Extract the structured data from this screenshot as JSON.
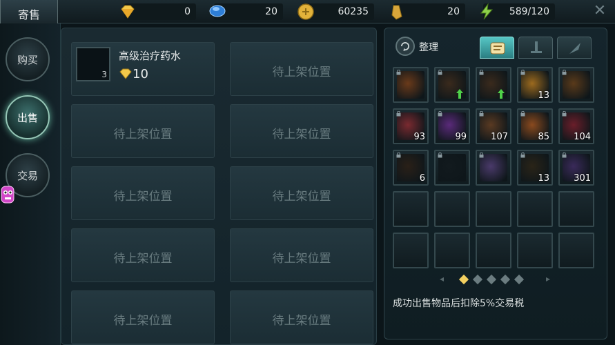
{
  "title": "寄售",
  "resources": [
    {
      "icon": "diamond-icon",
      "value": "0"
    },
    {
      "icon": "blue-gem-icon",
      "value": "20"
    },
    {
      "icon": "gold-coin-icon",
      "value": "60235"
    },
    {
      "icon": "gold-crystal-icon",
      "value": "20"
    },
    {
      "icon": "energy-icon",
      "value": "589/120"
    }
  ],
  "nav": {
    "buy": "购买",
    "sell": "出售",
    "trade": "交易",
    "active": "sell"
  },
  "listing": {
    "item_name": "高级治疗药水",
    "quantity": "3",
    "price": "10",
    "empty_label": "待上架位置"
  },
  "inventory": {
    "sort_label": "整理",
    "tabs": [
      "scroll-tab-icon",
      "sword-tab-icon",
      "feather-tab-icon"
    ],
    "active_tab": 0,
    "rows": [
      [
        {
          "art": "#6a3a1a",
          "qty": ""
        },
        {
          "art": "#3a2a1c",
          "qty": "",
          "up": true
        },
        {
          "art": "#3a2a1c",
          "qty": "",
          "up": true
        },
        {
          "art": "#9c6a1e",
          "qty": "13"
        },
        {
          "art": "#5a3a1a",
          "qty": ""
        }
      ],
      [
        {
          "art": "#7a2a30",
          "qty": "93"
        },
        {
          "art": "#5a2a7a",
          "qty": "99"
        },
        {
          "art": "#5a3a22",
          "qty": "107"
        },
        {
          "art": "#8a4a1e",
          "qty": "85"
        },
        {
          "art": "#6a1e2a",
          "qty": "104"
        }
      ],
      [
        {
          "art": "#2a2018",
          "qty": "6"
        },
        {
          "art": "#121a1e",
          "qty": ""
        },
        {
          "art": "#4a3a6a",
          "qty": ""
        },
        {
          "art": "#2a2418",
          "qty": "13"
        },
        {
          "art": "#3a2a5a",
          "qty": "301"
        }
      ],
      [
        {
          "art": "",
          "qty": ""
        },
        {
          "art": "",
          "qty": ""
        },
        {
          "art": "",
          "qty": ""
        },
        {
          "art": "",
          "qty": ""
        },
        {
          "art": "",
          "qty": ""
        }
      ],
      [
        {
          "art": "",
          "qty": ""
        },
        {
          "art": "",
          "qty": ""
        },
        {
          "art": "",
          "qty": ""
        },
        {
          "art": "",
          "qty": ""
        },
        {
          "art": "",
          "qty": ""
        }
      ]
    ],
    "page": 1,
    "page_count": 5,
    "tax_note": "成功出售物品后扣除5%交易税"
  },
  "colors": {
    "accent": "#56c6c4",
    "gold": "#f3d060",
    "panel": "#1b2d34"
  }
}
